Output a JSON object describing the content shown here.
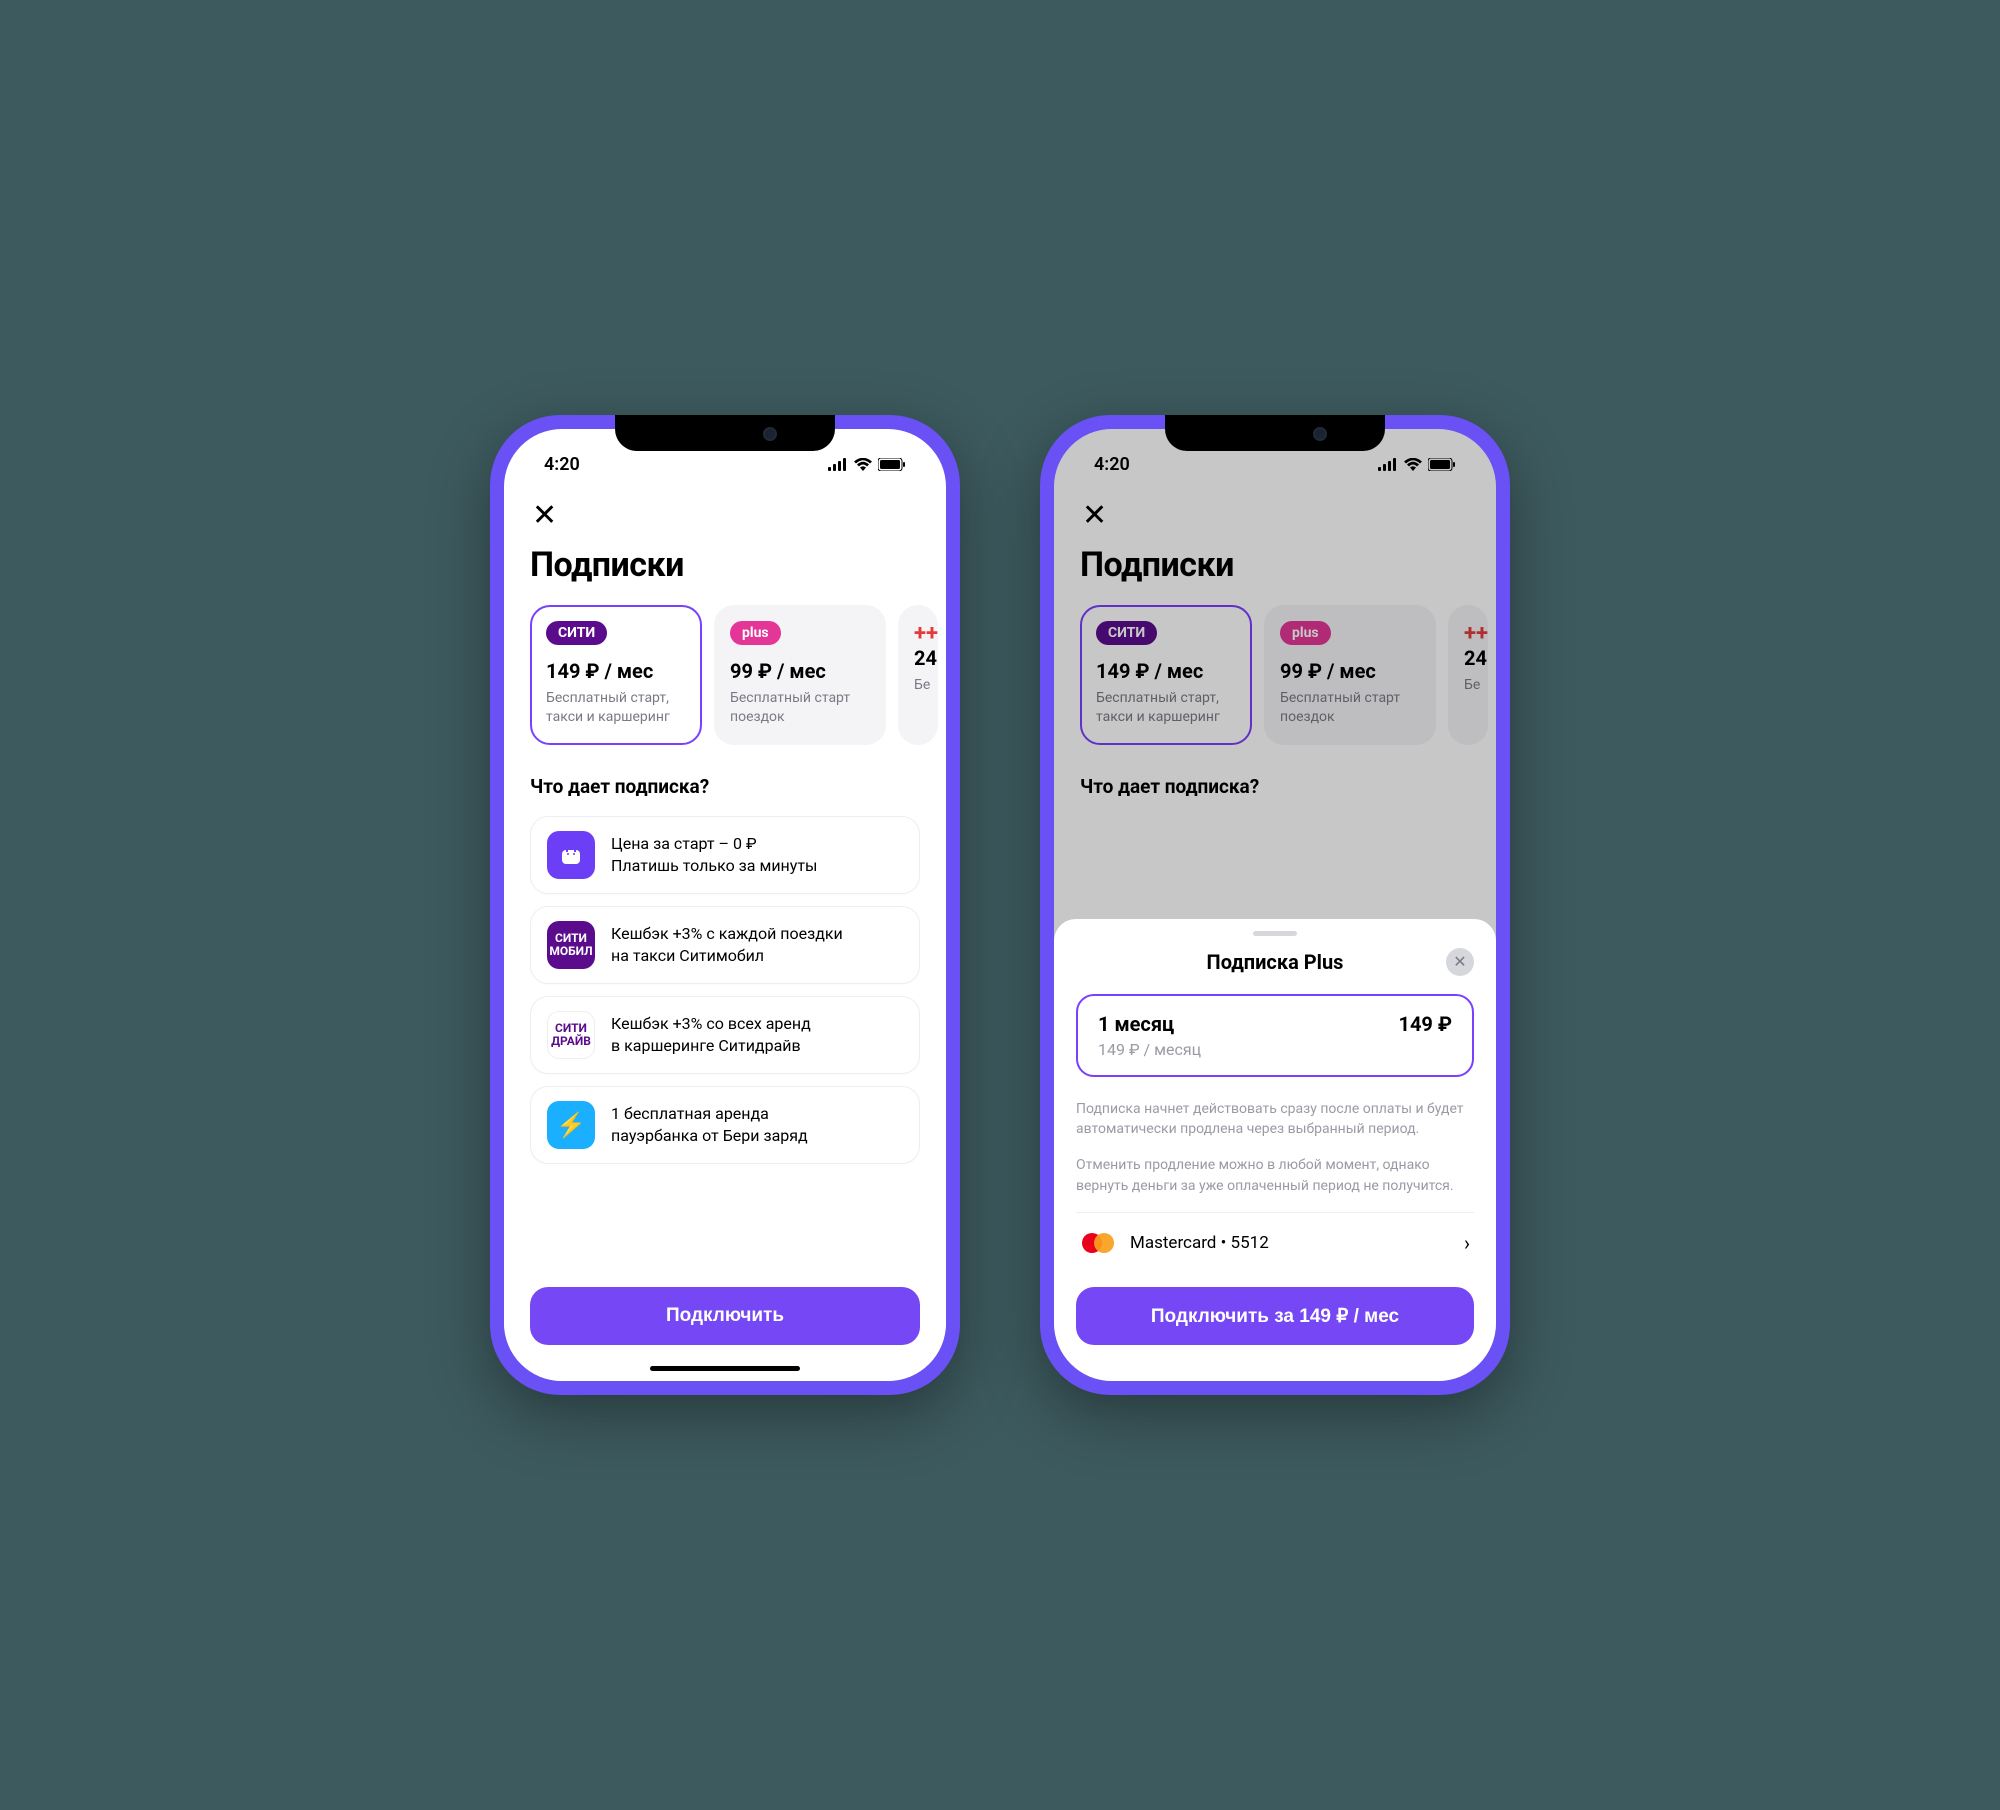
{
  "status": {
    "time": "4:20"
  },
  "page_title": "Подписки",
  "plans": [
    {
      "badge": "СИТИ",
      "price": "149 ₽ / мес",
      "desc": "Бесплатный старт, такси и каршеринг"
    },
    {
      "badge": "plus",
      "price": "99 ₽ / мес",
      "desc": "Бесплатный старт поездок"
    },
    {
      "badge": "++",
      "price": "24",
      "desc": "Бе"
    }
  ],
  "benefits_title": "Что дает подписка?",
  "benefits": [
    {
      "line1": "Цена за старт – 0 ₽",
      "line2": "Платишь только за минуты"
    },
    {
      "line1": "Кешбэк +3% с каждой поездки",
      "line2": "на такси Ситимобил"
    },
    {
      "line1": "Кешбэк +3% со всех аренд",
      "line2": "в каршеринге Ситидрайв"
    },
    {
      "line1": "1 бесплатная аренда",
      "line2": "пауэрбанка от Бери заряд"
    }
  ],
  "cta_primary": "Подключить",
  "sheet": {
    "title": "Подписка Plus",
    "period_label": "1 месяц",
    "period_price": "149 ₽",
    "period_sub": "149 ₽ / месяц",
    "legal1": "Подписка начнет действовать сразу после оплаты и будет автоматически продлена через выбранный период.",
    "legal2": "Отменить продление можно в любой момент, однако вернуть деньги за уже оплаченный период не получится.",
    "payment_label": "Mastercard • 5512",
    "cta": "Подключить за 149 ₽ / мес"
  },
  "icon_labels": {
    "citymobil": "СИТИ\nМОБИЛ",
    "citydrive": "СИТИ\nДРАЙВ"
  }
}
